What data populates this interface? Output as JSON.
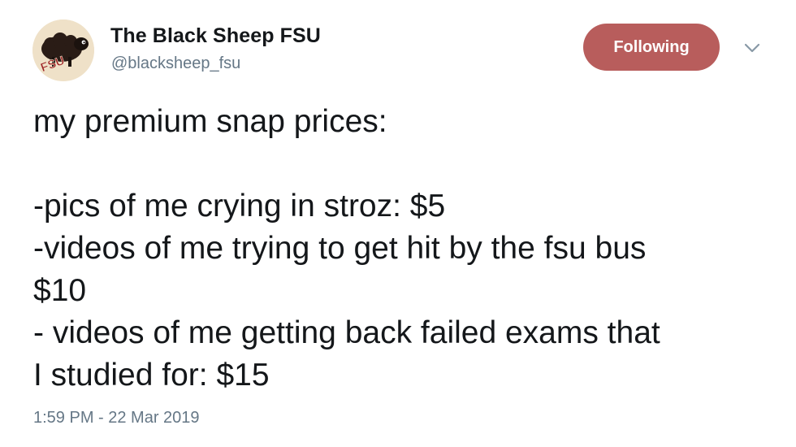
{
  "author": {
    "display_name": "The Black Sheep FSU",
    "handle": "@blacksheep_fsu",
    "avatar_text": "FSU",
    "avatar_icon": "sheep-logo"
  },
  "follow_button": {
    "label": "Following",
    "color": "#b85d5c"
  },
  "menu_icon": "chevron-down-icon",
  "tweet": {
    "lines": [
      "my premium snap prices:",
      "",
      "-pics of me crying in stroz: $5",
      "-videos of me trying to get hit by the fsu bus",
      "$10",
      "- videos of me getting back failed exams that",
      "I studied for: $15"
    ],
    "timestamp": "1:59 PM - 22 Mar 2019"
  }
}
